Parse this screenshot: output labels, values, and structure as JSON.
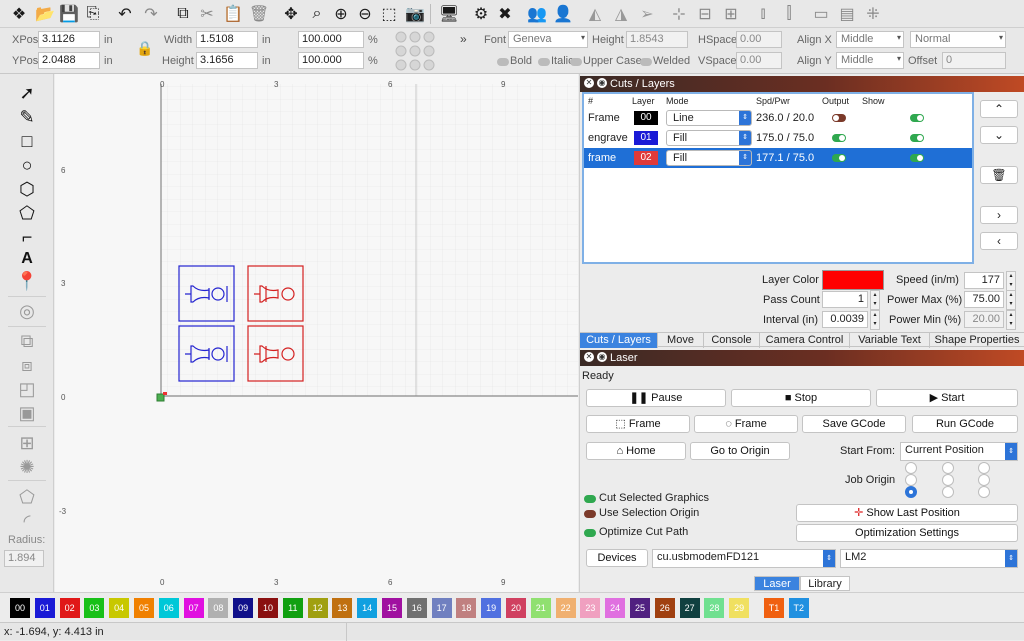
{
  "props": {
    "xpos_label": "XPos",
    "xpos": "3.1126",
    "xpos_unit": "in",
    "ypos_label": "YPos",
    "ypos": "2.0488",
    "ypos_unit": "in",
    "width_label": "Width",
    "width": "1.5108",
    "width_unit": "in",
    "height_label": "Height",
    "height": "3.1656",
    "height_unit": "in",
    "scale_w": "100.000",
    "scale_h": "100.000",
    "pct": "%",
    "font_label": "Font",
    "font": "Geneva",
    "fheight_label": "Height",
    "fheight": "1.8543",
    "hspace_label": "HSpace",
    "hspace": "0.00",
    "vspace_label": "VSpace",
    "vspace": "0.00",
    "alignx_label": "Align X",
    "alignx": "Middle",
    "aligny_label": "Align Y",
    "aligny": "Middle",
    "normal": "Normal",
    "offset_label": "Offset",
    "offset": "0",
    "bold": "Bold",
    "italic": "Italic",
    "uppercase": "Upper Case",
    "welded": "Welded"
  },
  "tools": {
    "radius_label": "Radius:",
    "radius": "1.894"
  },
  "rulers": {
    "top": [
      "0",
      "3",
      "6",
      "9"
    ],
    "left": [
      "6",
      "3",
      "0",
      "-3"
    ],
    "bottom": [
      "0",
      "3",
      "6",
      "9"
    ],
    "right_top": [
      "9"
    ]
  },
  "cuts_panel": {
    "title": "Cuts / Layers",
    "headers": [
      "#",
      "Layer",
      "Mode",
      "Spd/Pwr",
      "Output",
      "Show"
    ],
    "rows": [
      {
        "name": "Frame",
        "layer": "00",
        "color": "#000000",
        "mode": "Line",
        "spd": "236.0 / 20.0",
        "output": false,
        "show": true,
        "selected": false
      },
      {
        "name": "engrave",
        "layer": "01",
        "color": "#1a1ad6",
        "mode": "Fill",
        "spd": "175.0 / 75.0",
        "output": true,
        "show": true,
        "selected": false
      },
      {
        "name": "frame",
        "layer": "02",
        "color": "#e03a3a",
        "mode": "Fill",
        "spd": "177.1 / 75.0",
        "output": true,
        "show": true,
        "selected": true
      }
    ],
    "layer_color_label": "Layer Color",
    "layer_color": "#ff0000",
    "speed_label": "Speed (in/m)",
    "speed": "177",
    "pass_label": "Pass Count",
    "pass": "1",
    "pmax_label": "Power Max (%)",
    "pmax": "75.00",
    "interval_label": "Interval (in)",
    "interval": "0.0039",
    "pmin_label": "Power Min (%)",
    "pmin": "20.00"
  },
  "tabs": [
    "Cuts / Layers",
    "Move",
    "Console",
    "Camera Control",
    "Variable Text",
    "Shape Properties"
  ],
  "laser": {
    "title": "Laser",
    "status": "Ready",
    "pause": "Pause",
    "stop": "Stop",
    "start": "Start",
    "frame1": "Frame",
    "frame2": "Frame",
    "save_gcode": "Save GCode",
    "run_gcode": "Run GCode",
    "home": "Home",
    "go_origin": "Go to Origin",
    "start_from_label": "Start From:",
    "start_from": "Current Position",
    "job_origin_label": "Job Origin",
    "cut_selected": "Cut Selected Graphics",
    "use_selection": "Use Selection Origin",
    "optimize": "Optimize Cut Path",
    "show_last": "Show Last Position",
    "opt_settings": "Optimization Settings",
    "devices": "Devices",
    "port": "cu.usbmodemFD121",
    "machine": "LM2"
  },
  "bottom_tabs": [
    "Laser",
    "Library"
  ],
  "palette": [
    {
      "id": "00",
      "c": "#000000"
    },
    {
      "id": "01",
      "c": "#1a1ad6"
    },
    {
      "id": "02",
      "c": "#e01818"
    },
    {
      "id": "03",
      "c": "#18c018"
    },
    {
      "id": "04",
      "c": "#c8c800"
    },
    {
      "id": "05",
      "c": "#f08000"
    },
    {
      "id": "06",
      "c": "#00c8d8"
    },
    {
      "id": "07",
      "c": "#e010e0"
    },
    {
      "id": "08",
      "c": "#b0b0b0"
    },
    {
      "id": "09",
      "c": "#10108a"
    },
    {
      "id": "10",
      "c": "#8a1010"
    },
    {
      "id": "11",
      "c": "#10a010"
    },
    {
      "id": "12",
      "c": "#a0a010"
    },
    {
      "id": "13",
      "c": "#c07010"
    },
    {
      "id": "14",
      "c": "#10a0e0"
    },
    {
      "id": "15",
      "c": "#a010a0"
    },
    {
      "id": "16",
      "c": "#707070"
    },
    {
      "id": "17",
      "c": "#7080c0"
    },
    {
      "id": "18",
      "c": "#c08080"
    },
    {
      "id": "19",
      "c": "#5070e0"
    },
    {
      "id": "20",
      "c": "#d04060"
    },
    {
      "id": "21",
      "c": "#90e070"
    },
    {
      "id": "22",
      "c": "#f0b070"
    },
    {
      "id": "23",
      "c": "#f0a0c0"
    },
    {
      "id": "24",
      "c": "#e070e0"
    },
    {
      "id": "25",
      "c": "#502080"
    },
    {
      "id": "26",
      "c": "#a04010"
    },
    {
      "id": "27",
      "c": "#104040"
    },
    {
      "id": "28",
      "c": "#70e090"
    },
    {
      "id": "29",
      "c": "#f0e060"
    },
    {
      "id": "T1",
      "c": "#f06010"
    },
    {
      "id": "T2",
      "c": "#2090e0"
    }
  ],
  "status": "x: -1.694, y: 4.413 in",
  "icons": [
    "new-icon",
    "open-icon",
    "save-icon",
    "export-icon",
    "undo-icon",
    "redo-icon",
    "copy-icon",
    "cut-icon",
    "paste-icon",
    "delete-icon",
    "move-icon",
    "zoom-fit-icon",
    "zoom-in-icon",
    "zoom-out-icon",
    "select-box-icon",
    "camera-icon",
    "monitor-icon",
    "settings-icon",
    "tools-icon",
    "group-icon",
    "user-icon",
    "flip-h-icon",
    "flip-v-icon",
    "send-icon",
    "target-icon",
    "align-icon",
    "distribute-icon"
  ]
}
